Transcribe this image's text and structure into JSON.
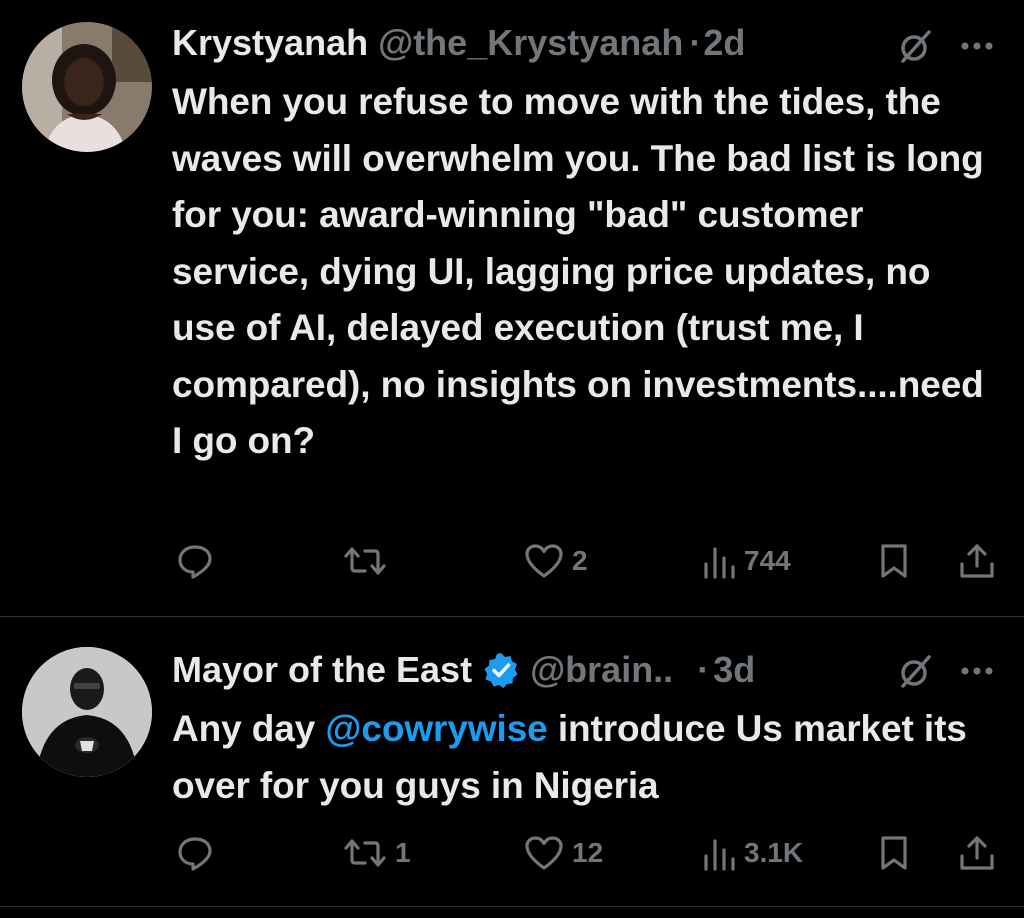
{
  "tweets": [
    {
      "author_name": "Krystyanah",
      "handle": "@the_Krystyanah",
      "dot": "·",
      "time": "2d",
      "verified": false,
      "text": "When you refuse to move with the tides, the waves will overwhelm you. The bad list is long for you: award-winning \"bad\" customer service, dying UI, lagging price updates, no use of AI, delayed execution (trust me, I compared), no insights on investments....need I go on?",
      "actions": {
        "replies": "",
        "reposts": "",
        "likes": "2",
        "views": "744"
      }
    },
    {
      "author_name": "Mayor of the East",
      "handle": "@brain..",
      "dot": "·",
      "time": "3d",
      "verified": true,
      "text_before": "Any day ",
      "mention": "@cowrywise",
      "text_after": " introduce Us market its over for you guys in Nigeria",
      "actions": {
        "replies": "",
        "reposts": "1",
        "likes": "12",
        "views": "3.1K"
      }
    }
  ],
  "colors": {
    "background": "#000000",
    "primary_text": "#e7e9ea",
    "secondary_text": "#71767b",
    "mention": "#1d9bf0",
    "verified_badge": "#1d9bf0",
    "divider": "#2f3336"
  },
  "icons": [
    "reply-icon",
    "repost-icon",
    "like-icon",
    "views-icon",
    "bookmark-icon",
    "share-icon",
    "grok-icon",
    "more-icon",
    "verified-badge-icon"
  ]
}
